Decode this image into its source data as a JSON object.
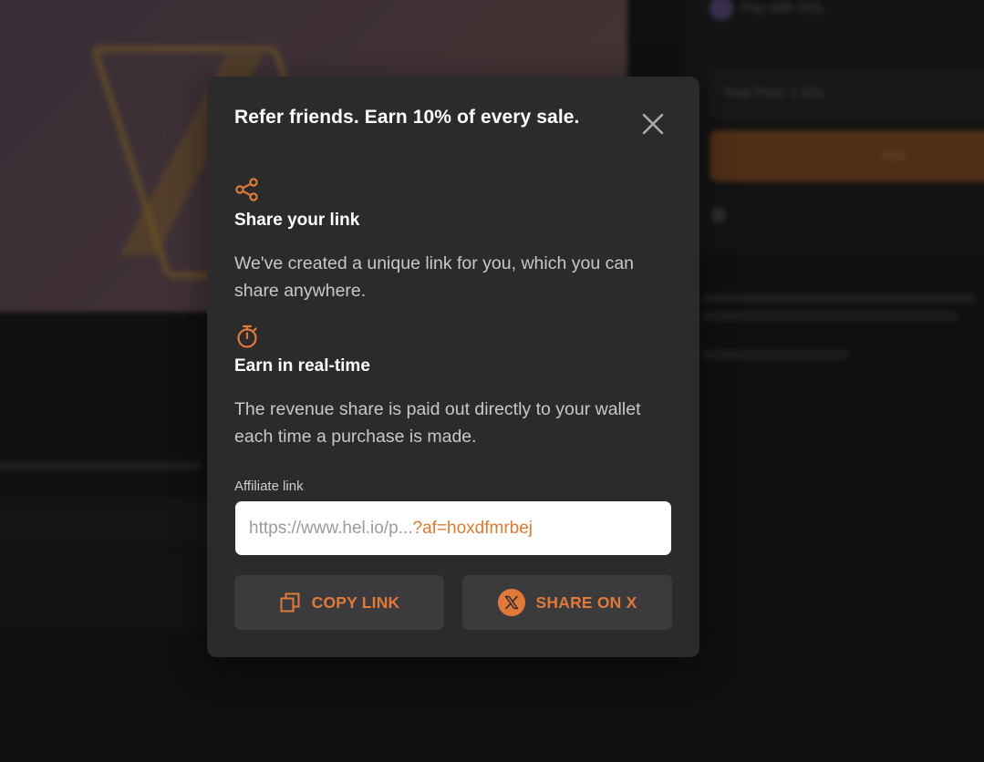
{
  "colors": {
    "accent": "#e1793a",
    "modal_bg": "#2b2b2c",
    "button_bg": "#3b3b3d",
    "text_muted": "#c8c8cc"
  },
  "background": {
    "pay_with": "Pay with SOL",
    "total_price": "Total Price: 1 SOL",
    "pay_button": "PAY"
  },
  "modal": {
    "title": "Refer friends. Earn 10% of every sale.",
    "close_icon": "close-icon",
    "sections": [
      {
        "icon": "share-icon",
        "heading": "Share your link",
        "text": "We've created a unique link for you, which you can share anywhere."
      },
      {
        "icon": "stopwatch-icon",
        "heading": "Earn in real-time",
        "text": "The revenue share is paid out directly to your wallet each time a purchase is made."
      }
    ],
    "affiliate": {
      "label": "Affiliate link",
      "link_base": "https://www.hel.io/p...",
      "link_param": "?af=hoxdfmrbej"
    },
    "buttons": {
      "copy_label": "COPY LINK",
      "copy_icon": "copy-icon",
      "share_label": "SHARE ON X",
      "share_icon": "x-logo-icon"
    }
  }
}
